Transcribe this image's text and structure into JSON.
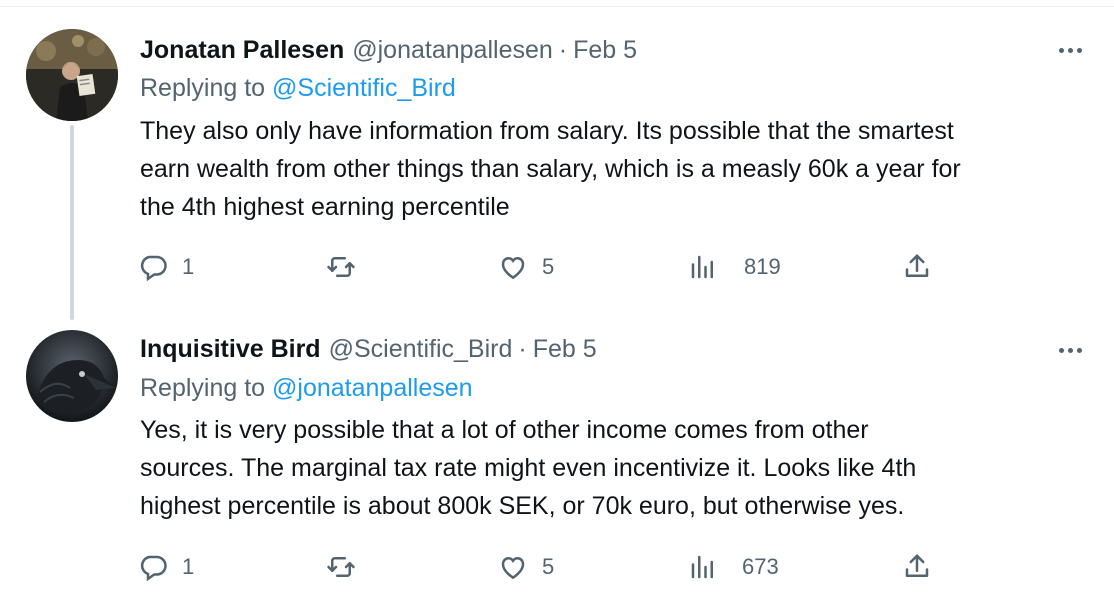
{
  "tweets": [
    {
      "author_name": "Jonatan Pallesen",
      "handle": "@jonatanpallesen",
      "separator": "·",
      "date": "Feb 5",
      "replying_prefix": "Replying to",
      "replying_to": "@Scientific_Bird",
      "body_lines": [
        "They also only have information from salary. Its possible that the smartest",
        "earn wealth from other things than salary, which is a measly 60k a year for",
        "the 4th highest earning percentile"
      ],
      "replies": "1",
      "likes": "5",
      "views": "819",
      "icons": {
        "avatar": "user-photo-avatar",
        "reply": "reply-icon",
        "retweet": "retweet-icon",
        "like": "heart-icon",
        "views": "views-icon",
        "share": "share-icon",
        "more": "more-icon"
      }
    },
    {
      "author_name": "Inquisitive Bird",
      "handle": "@Scientific_Bird",
      "separator": "·",
      "date": "Feb 5",
      "replying_prefix": "Replying to",
      "replying_to": "@jonatanpallesen",
      "body_lines": [
        "Yes, it is very possible that a lot of other income comes from other",
        "sources. The marginal tax rate might even incentivize it. Looks like 4th",
        "highest percentile is about 800k SEK, or 70k euro, but otherwise yes."
      ],
      "replies": "1",
      "likes": "5",
      "views": "673",
      "icons": {
        "avatar": "raven-avatar",
        "reply": "reply-icon",
        "retweet": "retweet-icon",
        "like": "heart-icon",
        "views": "views-icon",
        "share": "share-icon",
        "more": "more-icon"
      }
    }
  ],
  "colors": {
    "text": "#0f1419",
    "muted": "#536471",
    "link": "#1d9bf0",
    "thread_line": "#cfd9de"
  }
}
